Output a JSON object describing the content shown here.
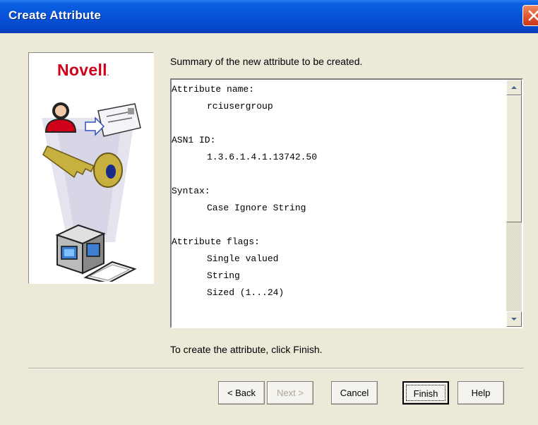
{
  "window": {
    "title": "Create Attribute"
  },
  "logo": {
    "text": "Novell",
    "mark": "."
  },
  "summary": {
    "heading": "Summary of the new attribute to be created.",
    "lines": [
      {
        "text": "Attribute name:",
        "indent": false
      },
      {
        "text": "rciusergroup",
        "indent": true
      },
      {
        "text": "",
        "indent": false
      },
      {
        "text": "ASN1 ID:",
        "indent": false
      },
      {
        "text": "1.3.6.1.4.1.13742.50",
        "indent": true
      },
      {
        "text": "",
        "indent": false
      },
      {
        "text": "Syntax:",
        "indent": false
      },
      {
        "text": "Case Ignore String",
        "indent": true
      },
      {
        "text": "",
        "indent": false
      },
      {
        "text": "Attribute flags:",
        "indent": false
      },
      {
        "text": "Single valued",
        "indent": true
      },
      {
        "text": "String",
        "indent": true
      },
      {
        "text": "Sized (1...24)",
        "indent": true
      }
    ]
  },
  "footer_text": "To create the attribute, click Finish.",
  "buttons": {
    "back": "< Back",
    "next": "Next >",
    "cancel": "Cancel",
    "finish": "Finish",
    "help": "Help"
  },
  "icons": {
    "close": "close-icon",
    "illustration": "novell-security-illustration",
    "scroll_up": "scroll-up-arrow-icon",
    "scroll_down": "scroll-down-arrow-icon"
  },
  "colors": {
    "title_bar": "#0751d6",
    "logo": "#d0021b",
    "dialog_bg": "#ece9d8",
    "close_button": "#e0502c"
  },
  "state": {
    "next_enabled": false,
    "focused_button": "finish"
  }
}
